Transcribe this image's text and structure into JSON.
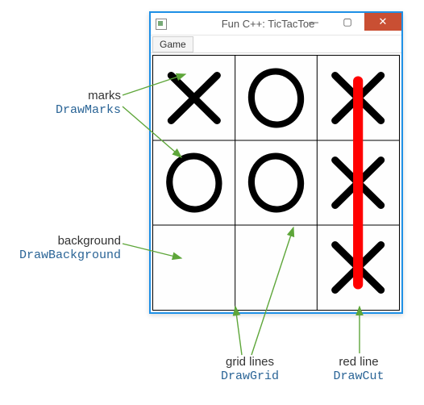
{
  "window": {
    "title": "Fun C++: TicTacToe",
    "min_label": "—",
    "max_label": "▢",
    "close_label": "✕"
  },
  "menubar": {
    "game_label": "Game"
  },
  "board": {
    "grid": [
      [
        "X",
        "O",
        "X"
      ],
      [
        "O",
        "O",
        "X"
      ],
      [
        "",
        "",
        "X"
      ]
    ],
    "cut": {
      "col": 2,
      "from_row": 0,
      "to_row": 2
    },
    "cut_color": "#ff0000"
  },
  "annotations": {
    "marks_title": "marks",
    "marks_fn": "DrawMarks",
    "background_title": "background",
    "background_fn": "DrawBackground",
    "gridlines_title": "grid lines",
    "gridlines_fn": "DrawGrid",
    "redline_title": "red line",
    "redline_fn": "DrawCut"
  },
  "colors": {
    "window_border": "#1e90e6",
    "arrow": "#5ea63a",
    "fn_text": "#2a6496"
  }
}
